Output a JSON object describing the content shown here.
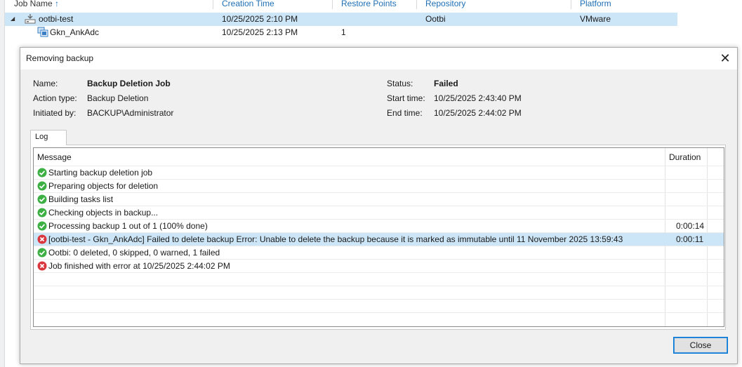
{
  "joblist": {
    "columns": {
      "job_name": "Job Name",
      "sort_arrow": "↑",
      "creation_time": "Creation Time",
      "restore_points": "Restore Points",
      "repository": "Repository",
      "platform": "Platform"
    },
    "rows": [
      {
        "name": "ootbi-test",
        "creation_time": "10/25/2025 2:10 PM",
        "restore_points": "",
        "repository": "Ootbi",
        "platform": "VMware"
      },
      {
        "name": "Gkn_AnkAdc",
        "creation_time": "10/25/2025 2:13 PM",
        "restore_points": "1",
        "repository": "",
        "platform": ""
      }
    ]
  },
  "dialog": {
    "title": "Removing backup",
    "close_glyph": "✕",
    "info": {
      "name_label": "Name:",
      "name_value": "Backup Deletion Job",
      "action_label": "Action type:",
      "action_value": "Backup Deletion",
      "initiated_label": "Initiated by:",
      "initiated_value": "BACKUP\\Administrator",
      "status_label": "Status:",
      "status_value": "Failed",
      "start_label": "Start time:",
      "start_value": "10/25/2025 2:43:40 PM",
      "end_label": "End time:",
      "end_value": "10/25/2025 2:44:02 PM"
    },
    "tab_log": "Log",
    "grid": {
      "col_message": "Message",
      "col_duration": "Duration",
      "rows": [
        {
          "status": "success",
          "message": "Starting backup deletion job",
          "duration": ""
        },
        {
          "status": "success",
          "message": "Preparing objects for deletion",
          "duration": ""
        },
        {
          "status": "success",
          "message": "Building tasks list",
          "duration": ""
        },
        {
          "status": "success",
          "message": "Checking objects in backup...",
          "duration": ""
        },
        {
          "status": "success",
          "message": "Processing backup 1 out of 1 (100% done)",
          "duration": "0:00:14"
        },
        {
          "status": "error",
          "message": "[ootbi-test - Gkn_AnkAdc] Failed to delete backup Error: Unable to delete the backup because it is marked as immutable until 11 November 2025 13:59:43",
          "duration": "0:00:11"
        },
        {
          "status": "success",
          "message": "Ootbi: 0 deleted, 0 skipped, 0 warned, 1 failed",
          "duration": ""
        },
        {
          "status": "error",
          "message": "Job finished with error at 10/25/2025 2:44:02 PM",
          "duration": ""
        }
      ]
    },
    "close_button": "Close"
  },
  "colors": {
    "success": "#3cb043",
    "error": "#d9363e",
    "selection": "#cde6f7",
    "link_header": "#1e6fb4"
  },
  "icons": [
    "job-icon",
    "vm-icon",
    "check-icon",
    "error-icon",
    "close-icon",
    "expand-arrow-icon"
  ]
}
